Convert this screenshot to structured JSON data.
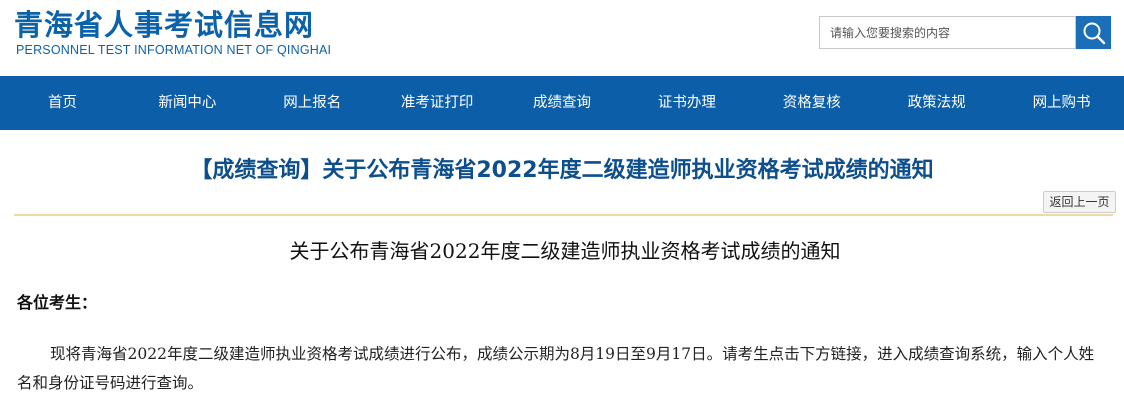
{
  "site": {
    "title_cn": "青海省人事考试信息网",
    "title_en": "PERSONNEL TEST INFORMATION NET OF QINGHAI"
  },
  "search": {
    "placeholder": "请输入您要搜索的内容",
    "icon": "search-icon",
    "button_color": "#1a6fb8"
  },
  "nav": {
    "items": [
      {
        "label": "首页"
      },
      {
        "label": "新闻中心"
      },
      {
        "label": "网上报名"
      },
      {
        "label": "准考证打印"
      },
      {
        "label": "成绩查询"
      },
      {
        "label": "证书办理"
      },
      {
        "label": "资格复核"
      },
      {
        "label": "政策法规"
      },
      {
        "label": "网上购书"
      }
    ],
    "background_color": "#0d5ea8"
  },
  "article": {
    "title": "【成绩查询】关于公布青海省2022年度二级建造师执业资格考试成绩的通知",
    "back_label": "返回上一页",
    "content_title": "关于公布青海省2022年度二级建造师执业资格考试成绩的通知",
    "greeting": "各位考生：",
    "paragraph": "现将青海省2022年度二级建造师执业资格考试成绩进行公布，成绩公示期为8月19日至9月17日。请考生点击下方链接，进入成绩查询系统，输入个人姓名和身份证号码进行查询。"
  },
  "colors": {
    "brand": "#0c62a8",
    "title": "#0c4f8c",
    "divider": "#f1d9a6"
  }
}
